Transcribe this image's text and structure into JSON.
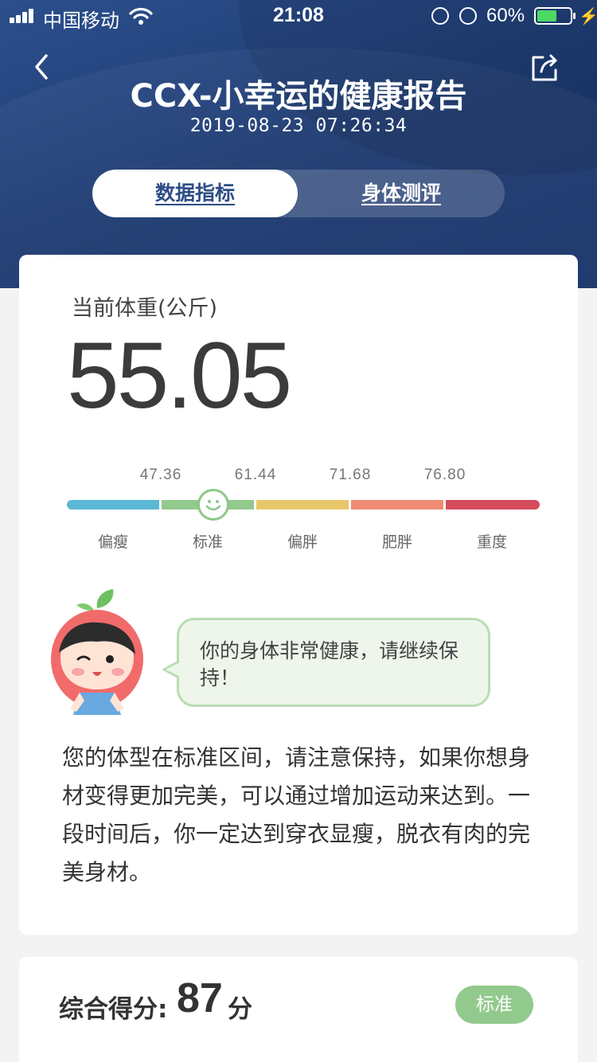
{
  "status_bar": {
    "carrier": "中国移动",
    "time": "21:08",
    "battery_percent": "60%",
    "battery_level": 0.6,
    "icons": [
      "signal-icon",
      "wifi-icon",
      "orientation-lock-icon",
      "alarm-icon",
      "battery-icon",
      "charging-icon"
    ]
  },
  "header": {
    "title": "CCX-小幸运的健康报告",
    "datetime": "2019-08-23 07:26:34",
    "back_icon": "chevron-left-icon",
    "share_icon": "share-icon"
  },
  "tabs": [
    {
      "label": "数据指标",
      "active": true
    },
    {
      "label": "身体测评",
      "active": false
    }
  ],
  "weight": {
    "label": "当前体重(公斤)",
    "value": "55.05",
    "thresholds": [
      "47.36",
      "61.44",
      "71.68",
      "76.80"
    ],
    "categories": [
      "偏瘦",
      "标准",
      "偏胖",
      "肥胖",
      "重度"
    ],
    "category_colors": [
      "#5ab8d6",
      "#92c98d",
      "#e8c76c",
      "#ef8b74",
      "#d44b5c"
    ],
    "current_category": "标准"
  },
  "bubble": {
    "text": "你的身体非常健康，请继续保持！"
  },
  "description": "您的体型在标准区间，请注意保持，如果你想身材变得更加完美，可以通过增加运动来达到。一段时间后，你一定达到穿衣显瘦，脱衣有肉的完美身材。",
  "score": {
    "label": "综合得分:",
    "value": "87",
    "unit": "分",
    "badge": "标准"
  },
  "colors": {
    "header_bg": "#1d3a70",
    "accent_blue": "#2e4d86",
    "standard_green": "#92c98d"
  }
}
